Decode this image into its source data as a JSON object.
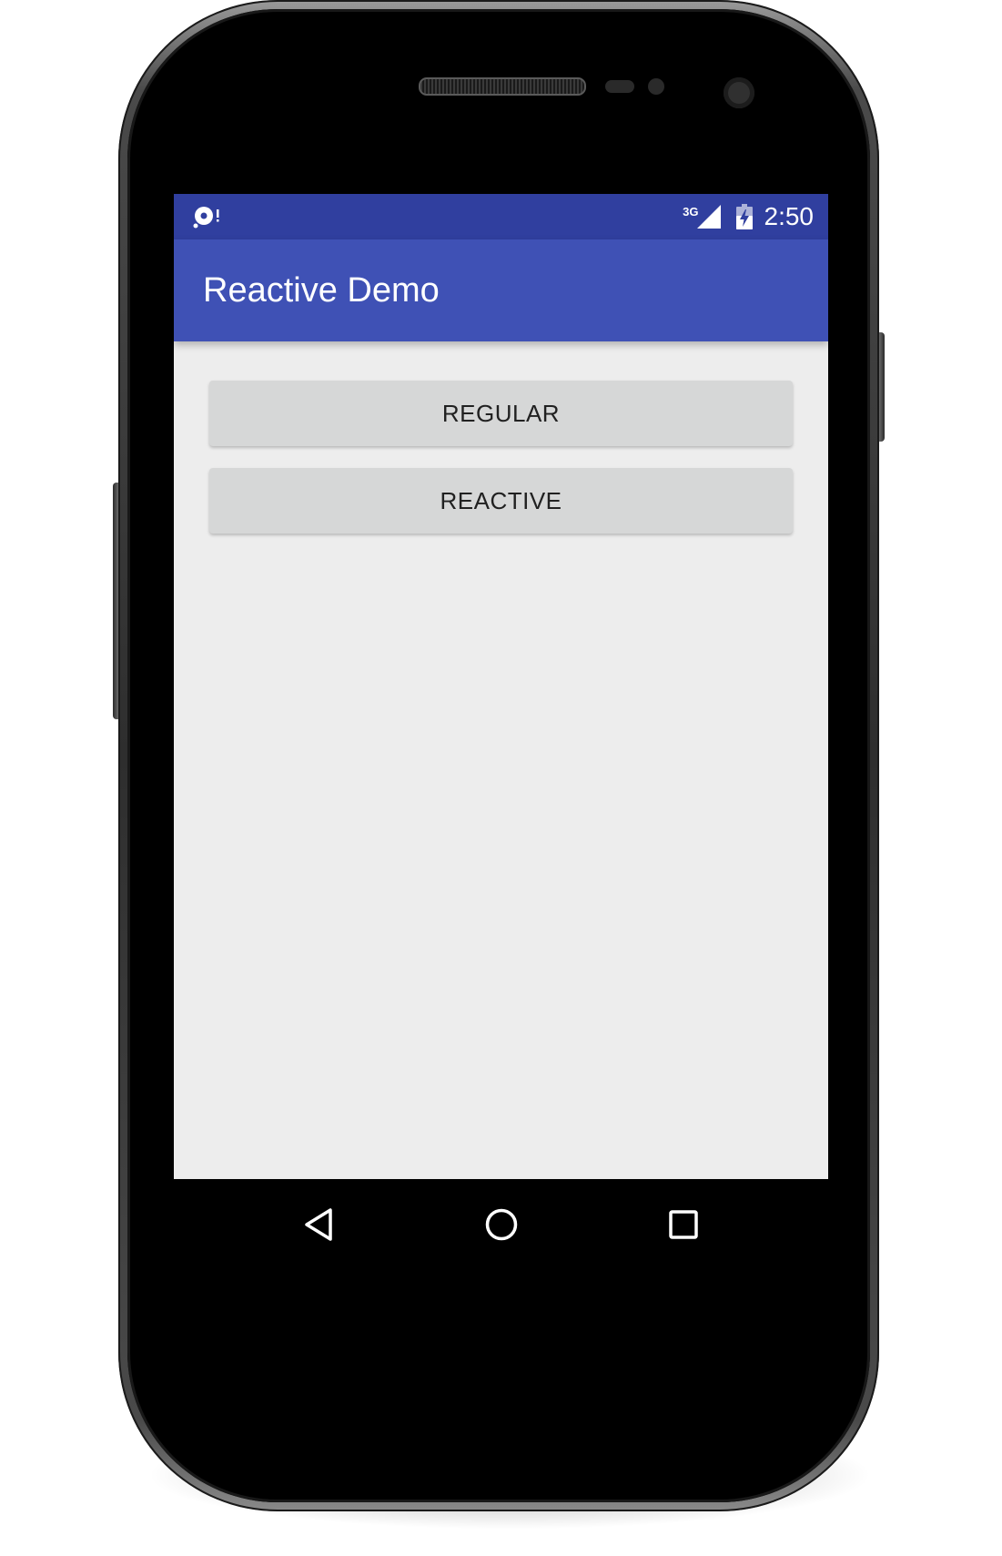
{
  "status_bar": {
    "network_type": "3G",
    "time": "2:50",
    "notification_icon": "disc-sync-icon",
    "signal_icon": "cell-signal-icon",
    "battery_icon": "battery-charging-icon"
  },
  "app_bar": {
    "title": "Reactive Demo"
  },
  "content": {
    "buttons": [
      {
        "label": "REGULAR"
      },
      {
        "label": "REACTIVE"
      }
    ]
  },
  "nav_bar": {
    "back_icon": "back-triangle-icon",
    "home_icon": "home-circle-icon",
    "recents_icon": "recents-square-icon"
  },
  "colors": {
    "status_bar": "#303f9f",
    "app_bar": "#3f51b5",
    "background": "#ededed",
    "button": "#d6d7d7",
    "button_text": "#212121"
  }
}
